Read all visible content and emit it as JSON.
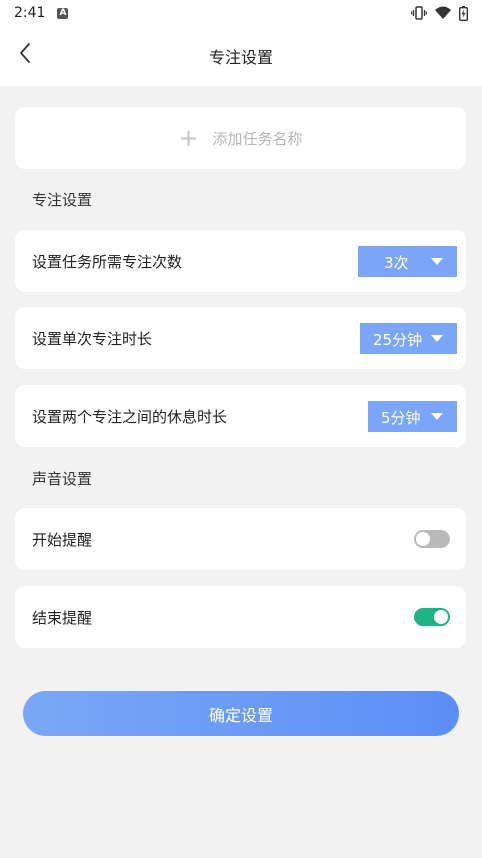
{
  "status_bar": {
    "time": "2:41",
    "icons": [
      "notification-a-icon",
      "vibrate-icon",
      "wifi-icon",
      "battery-icon"
    ]
  },
  "header": {
    "title": "专注设置",
    "back_icon": "chevron-left-icon"
  },
  "add_task": {
    "icon": "plus-icon",
    "placeholder": "添加任务名称"
  },
  "focus_section": {
    "label": "专注设置",
    "rows": [
      {
        "label": "设置任务所需专注次数",
        "value": "3次"
      },
      {
        "label": "设置单次专注时长",
        "value": "25分钟"
      },
      {
        "label": "设置两个专注之间的休息时长",
        "value": "5分钟"
      }
    ]
  },
  "sound_section": {
    "label": "声音设置",
    "rows": [
      {
        "label": "开始提醒",
        "enabled": false
      },
      {
        "label": "结束提醒",
        "enabled": true
      }
    ]
  },
  "confirm_button": {
    "label": "确定设置"
  },
  "colors": {
    "accent_blue": "#7ba5f8",
    "toggle_on": "#1fb385",
    "toggle_off": "#b9b9b9",
    "background": "#f2f2f2"
  }
}
